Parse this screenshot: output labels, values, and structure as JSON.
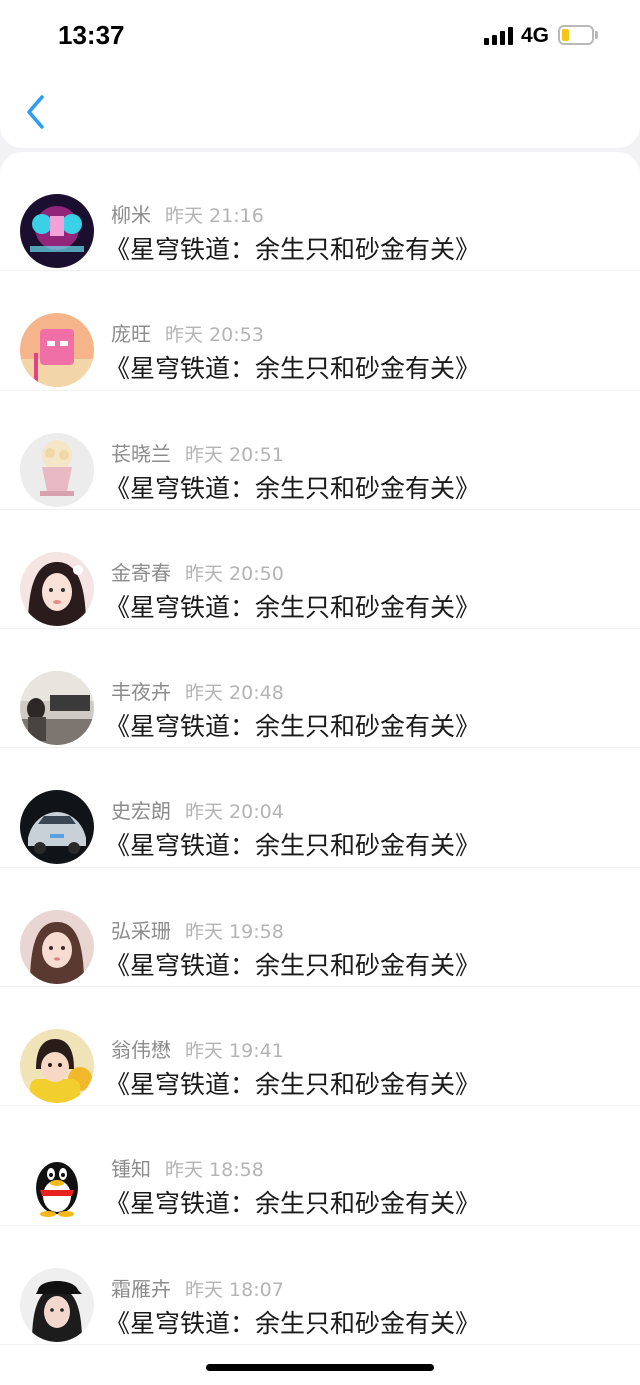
{
  "status_bar": {
    "time": "13:37",
    "network": "4G",
    "battery_level": 0.25
  },
  "nav": {
    "back_icon": "chevron-left-icon",
    "accent_color": "#2a9df4"
  },
  "list": {
    "items": [
      {
        "name": "柳米",
        "time": "昨天 21:16",
        "title": "《星穹铁道：余生只和砂金有关》"
      },
      {
        "name": "庞旺",
        "time": "昨天 20:53",
        "title": "《星穹铁道：余生只和砂金有关》"
      },
      {
        "name": "苌晓兰",
        "time": "昨天 20:51",
        "title": "《星穹铁道：余生只和砂金有关》"
      },
      {
        "name": "金寄春",
        "time": "昨天 20:50",
        "title": "《星穹铁道：余生只和砂金有关》"
      },
      {
        "name": "丰夜卉",
        "time": "昨天 20:48",
        "title": "《星穹铁道：余生只和砂金有关》"
      },
      {
        "name": "史宏朗",
        "time": "昨天 20:04",
        "title": "《星穹铁道：余生只和砂金有关》"
      },
      {
        "name": "弘采珊",
        "time": "昨天 19:58",
        "title": "《星穹铁道：余生只和砂金有关》"
      },
      {
        "name": "翁伟懋",
        "time": "昨天 19:41",
        "title": "《星穹铁道：余生只和砂金有关》"
      },
      {
        "name": "锺知",
        "time": "昨天 18:58",
        "title": "《星穹铁道：余生只和砂金有关》"
      },
      {
        "name": "霜雁卉",
        "time": "昨天 18:07",
        "title": "《星穹铁道：余生只和砂金有关》"
      }
    ]
  }
}
